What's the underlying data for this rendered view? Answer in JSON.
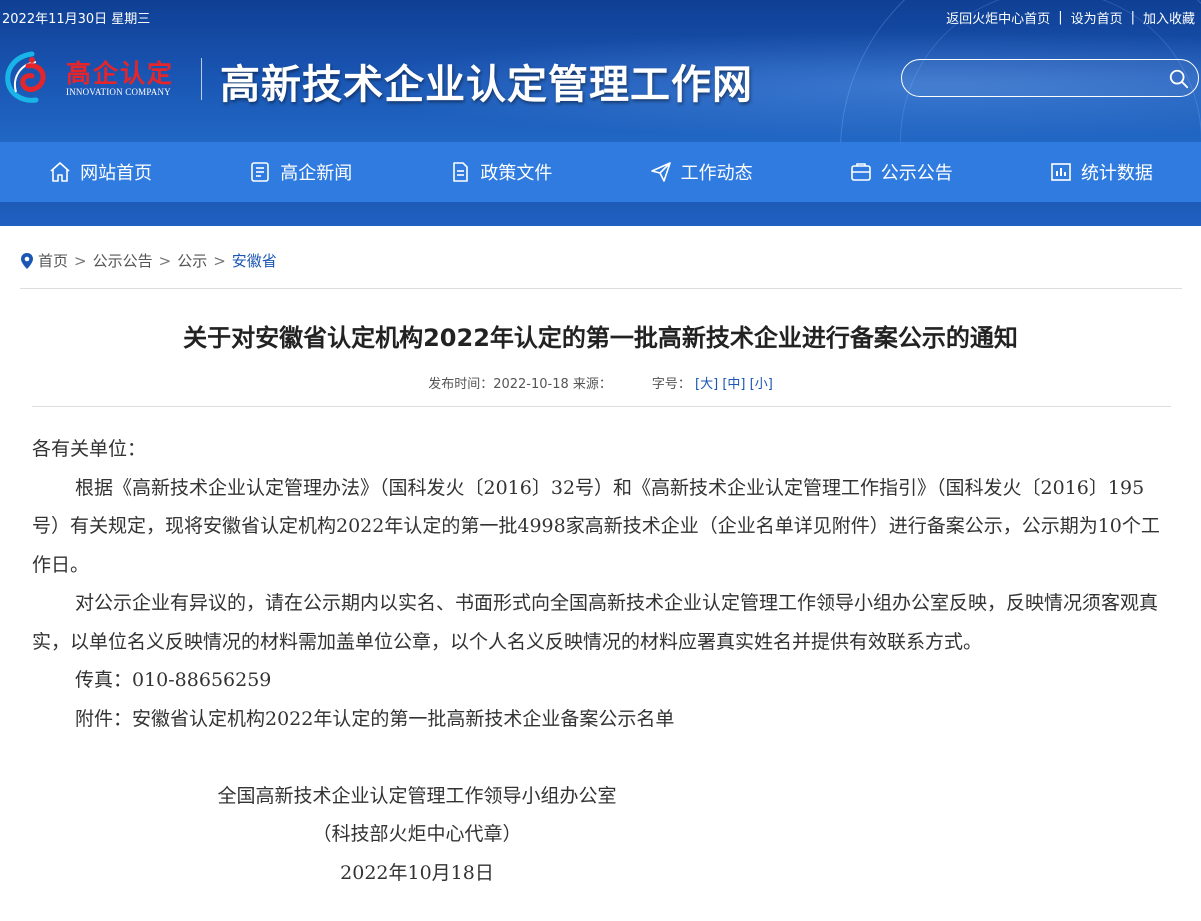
{
  "topbar": {
    "date": "2022年11月30日 星期三",
    "links": [
      "返回火炬中心首页",
      "设为首页",
      "加入收藏"
    ]
  },
  "logo": {
    "cn": "高企认定",
    "en": "INNOVATION COMPANY"
  },
  "site_title": "高新技术企业认定管理工作网",
  "search": {
    "placeholder": ""
  },
  "nav": [
    {
      "label": "网站首页",
      "icon": "home-icon"
    },
    {
      "label": "高企新闻",
      "icon": "news-icon"
    },
    {
      "label": "政策文件",
      "icon": "document-icon"
    },
    {
      "label": "工作动态",
      "icon": "send-icon"
    },
    {
      "label": "公示公告",
      "icon": "notice-icon"
    },
    {
      "label": "统计数据",
      "icon": "chart-icon"
    }
  ],
  "breadcrumb": [
    "首页",
    "公示公告",
    "公示",
    "安徽省"
  ],
  "article": {
    "title": "关于对安徽省认定机构2022年认定的第一批高新技术企业进行备案公示的通知",
    "meta_date": "发布时间：2022-10-18 来源：",
    "meta_font": "字号：",
    "font_sizes": [
      "[大]",
      "[中]",
      "[小]"
    ],
    "salutation": "各有关单位：",
    "paragraphs": [
      "根据《高新技术企业认定管理办法》（国科发火〔2016〕32号）和《高新技术企业认定管理工作指引》（国科发火〔2016〕195号）有关规定，现将安徽省认定机构2022年认定的第一批4998家高新技术企业（企业名单详见附件）进行备案公示，公示期为10个工作日。",
      "对公示企业有异议的，请在公示期内以实名、书面形式向全国高新技术企业认定管理工作领导小组办公室反映，反映情况须客观真实，以单位名义反映情况的材料需加盖单位公章，以个人名义反映情况的材料应署真实姓名并提供有效联系方式。",
      "传真：010-88656259",
      "附件：安徽省认定机构2022年认定的第一批高新技术企业备案公示名单"
    ],
    "signature": [
      "全国高新技术企业认定管理工作领导小组办公室",
      "（科技部火炬中心代章）",
      "2022年10月18日"
    ]
  }
}
